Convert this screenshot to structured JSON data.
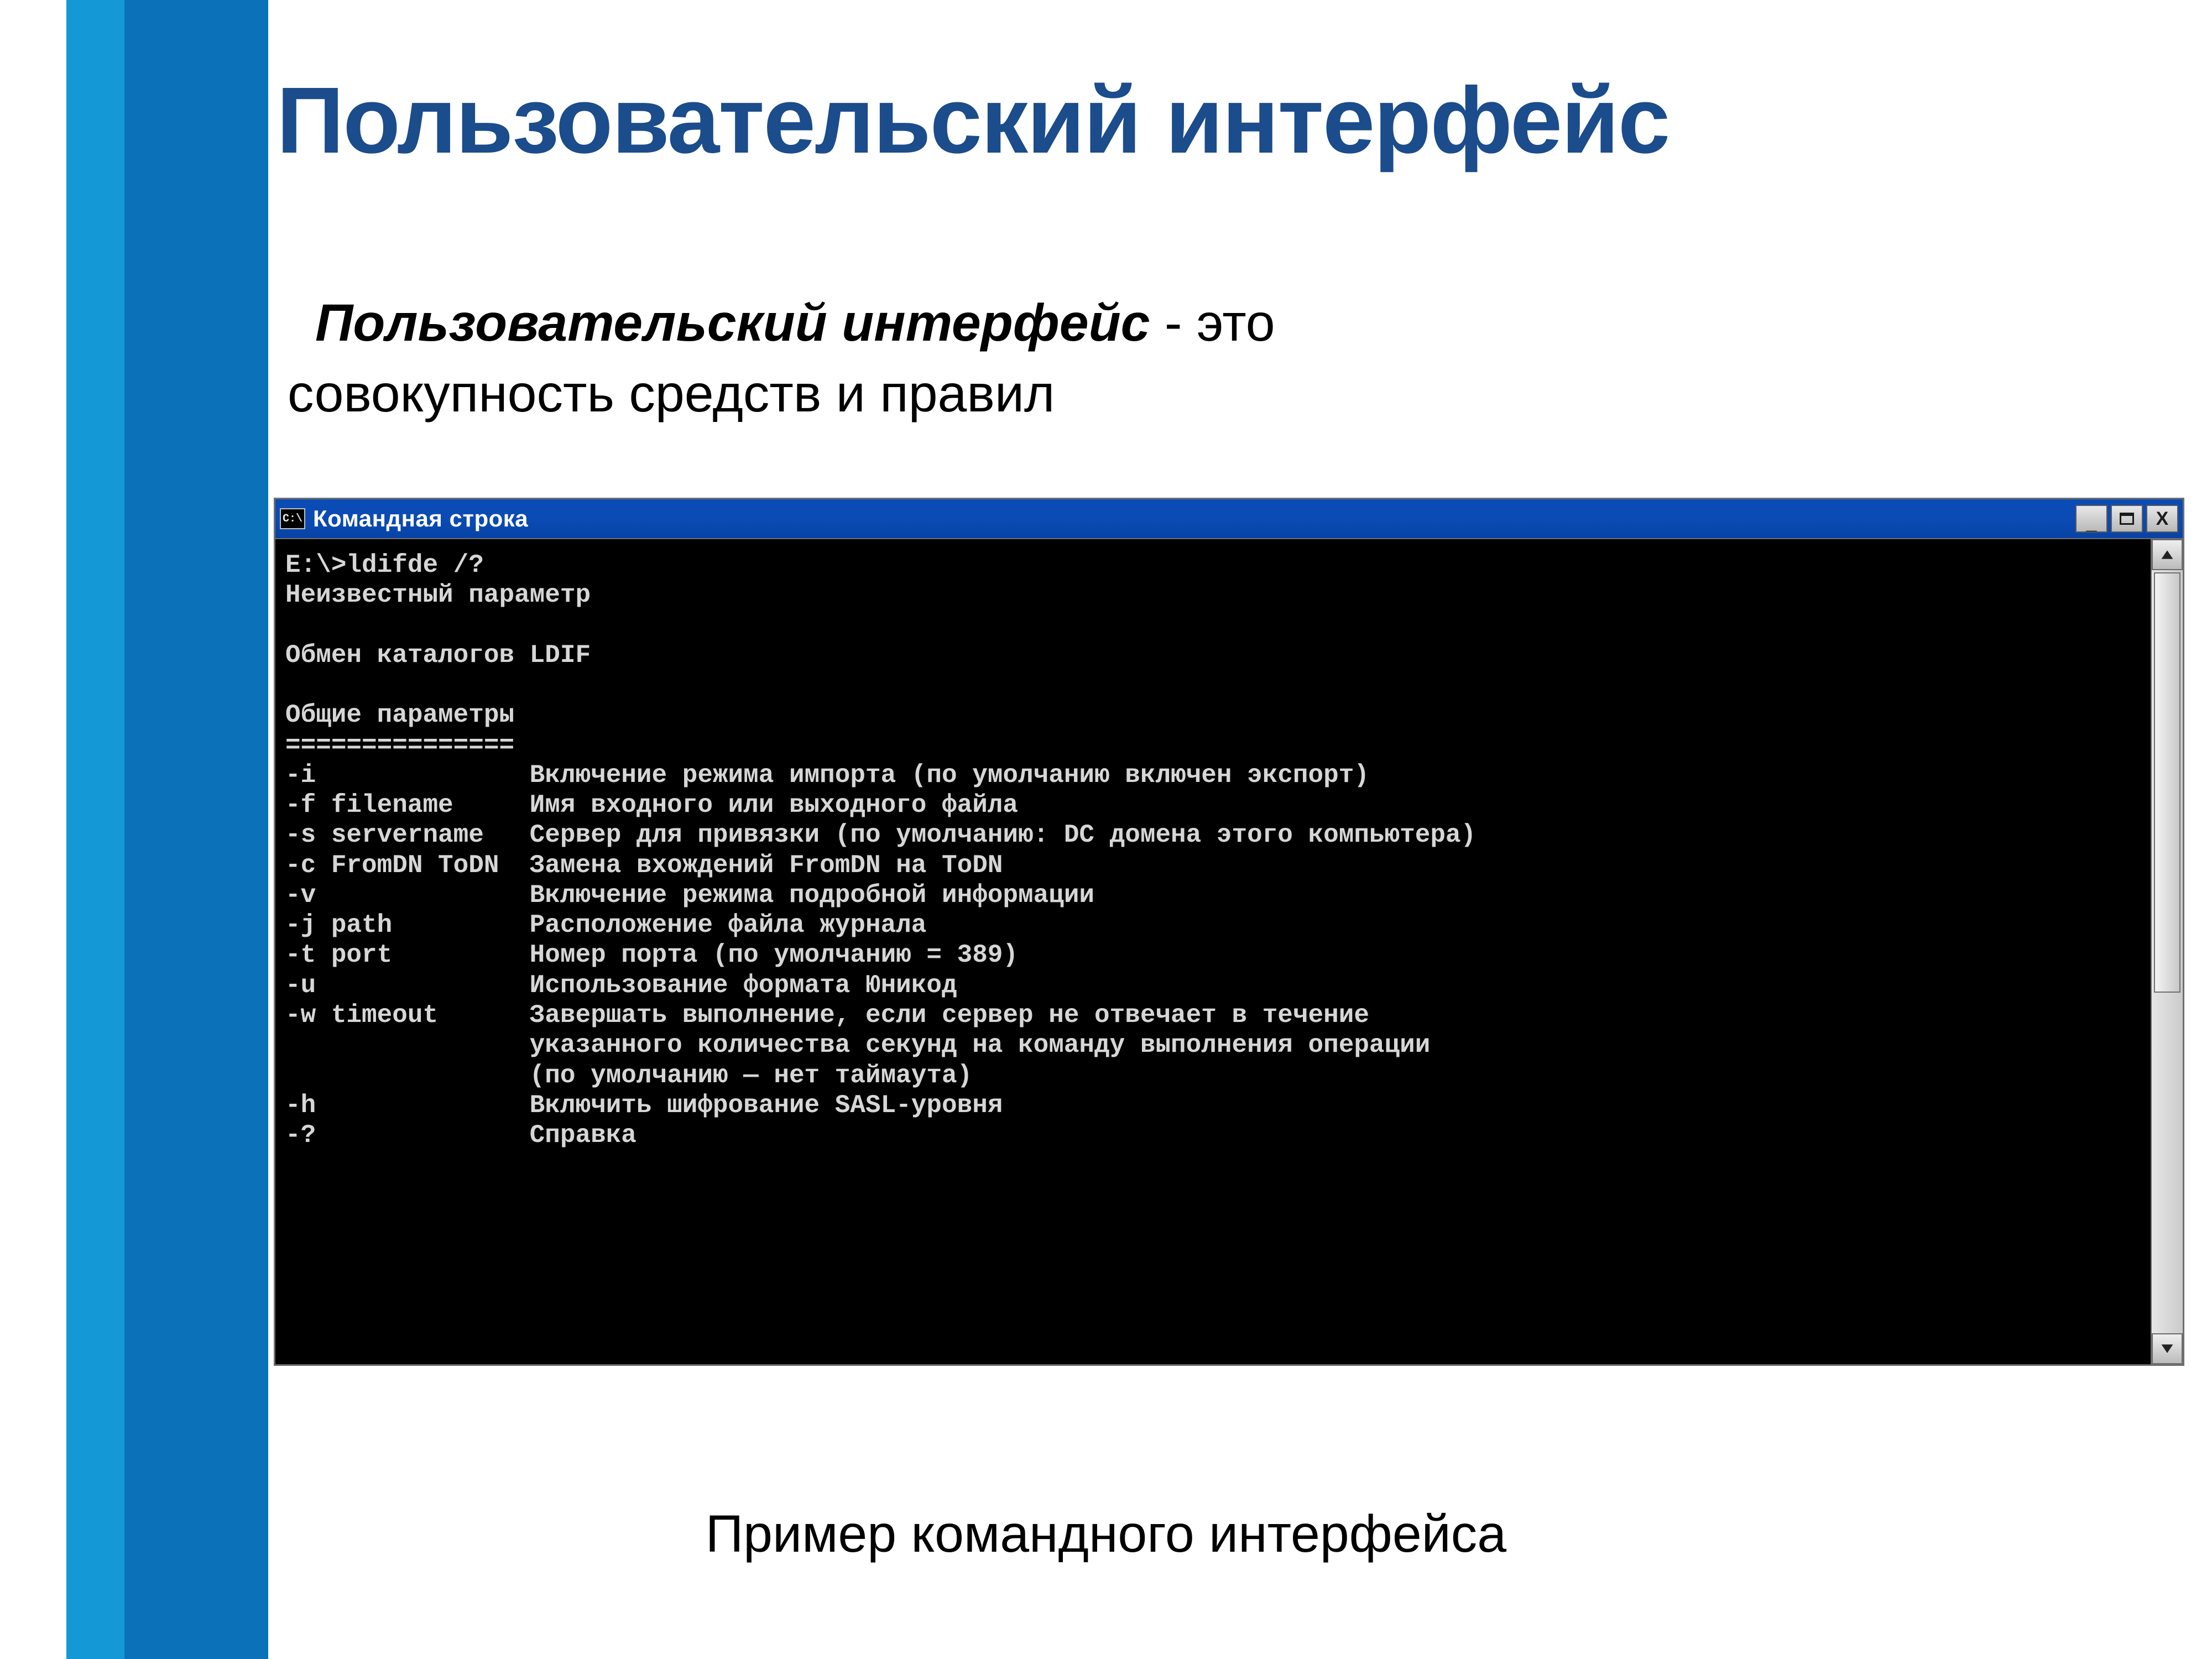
{
  "slide": {
    "title": "Пользовательский интерфейс",
    "definition": {
      "term": "Пользовательский интерфейс",
      "rest_line1": " - это",
      "line2": "совокупность средств и правил"
    },
    "caption": "Пример командного интерфейса"
  },
  "cmdwin": {
    "icon_text": "C:\\",
    "title": "Командная строка",
    "buttons": {
      "min": "_",
      "max": "▢",
      "close": "X"
    },
    "lines": [
      "E:\\>ldifde /?",
      "Неизвестный параметр",
      "",
      "Обмен каталогов LDIF",
      "",
      "Общие параметры",
      "===============",
      "-i              Включение режима импорта (по умолчанию включен экспорт)",
      "-f filename     Имя входного или выходного файла",
      "-s servername   Сервер для привязки (по умолчанию: DC домена этого компьютера)",
      "-c FromDN ToDN  Замена вхождений FromDN на ToDN",
      "-v              Включение режима подробной информации",
      "-j path         Расположение файла журнала",
      "-t port         Номер порта (по умолчанию = 389)",
      "-u              Использование формата Юникод",
      "-w timeout      Завершать выполнение, если сервер не отвечает в течение",
      "                указанного количества секунд на команду выполнения операции",
      "                (по умолчанию — нет таймаута)",
      "-h              Включить шифрование SASL-уровня",
      "-?              Справка",
      ""
    ]
  }
}
